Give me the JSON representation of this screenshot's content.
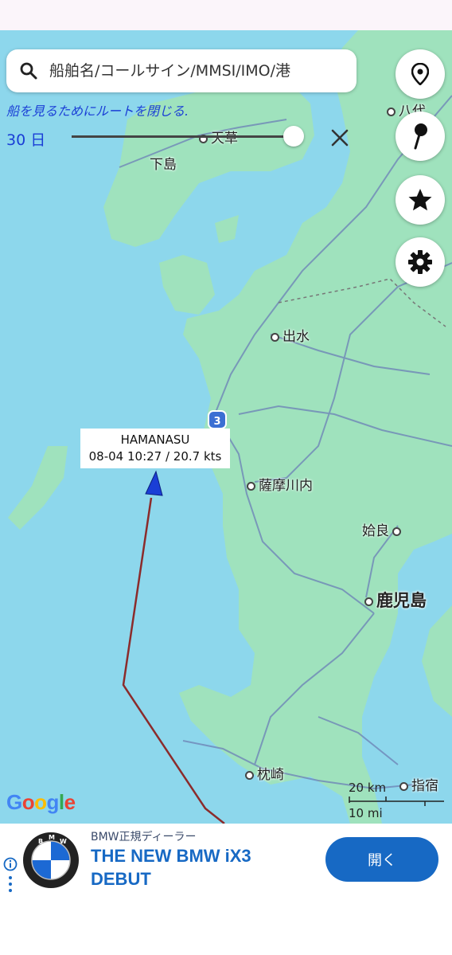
{
  "search": {
    "placeholder": "船舶名/コールサイン/MMSI/IMO/港"
  },
  "route": {
    "hint": "船を見るためにルートを閉じる.",
    "days_label": "30 日"
  },
  "map": {
    "places": {
      "yatsushiro": "八代",
      "amakusa": "天草",
      "shimoshima": "下島",
      "izumi": "出水",
      "satsumasendai": "薩摩川内",
      "aira": "姶良",
      "kagoshima": "鹿児島",
      "makurazaki": "枕崎",
      "ibusuki": "指宿"
    },
    "route_badge": "3",
    "attribution": "Google",
    "scale": {
      "km": "20 km",
      "mi": "10 mi"
    }
  },
  "vessel": {
    "name": "HAMANASU",
    "info": "08-04 10:27 / 20.7 kts"
  },
  "fabs": [
    {
      "icon": "location-pin-icon"
    },
    {
      "icon": "map-pin-icon"
    },
    {
      "icon": "star-icon"
    },
    {
      "icon": "gear-icon"
    }
  ],
  "ad": {
    "sponsor": "BMW正規ディーラー",
    "title": "THE NEW BMW iX3 DEBUT",
    "button": "開く"
  },
  "colors": {
    "sea": "#8dd7ec",
    "land": "#9fe2bd",
    "route_line": "#8b2b2b",
    "vessel": "#1a3ed6",
    "accent": "#1769c4"
  }
}
